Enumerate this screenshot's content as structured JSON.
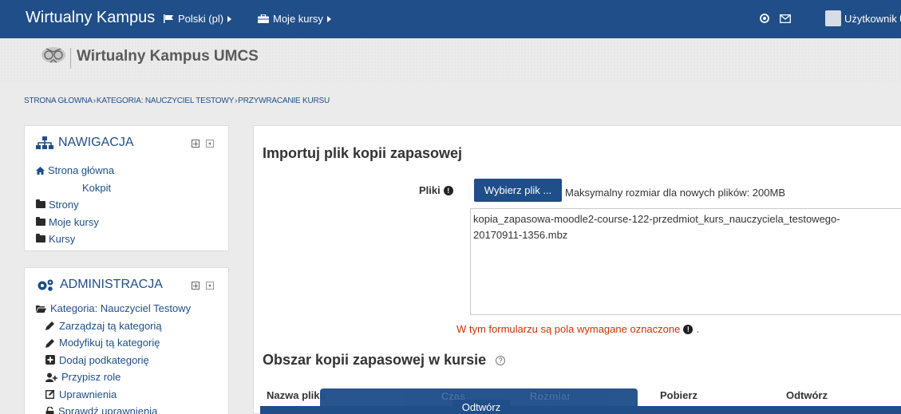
{
  "navbar": {
    "brand": "Wirtualny Kampus",
    "language": "Polski (pl)",
    "my_courses": "Moje kursy",
    "user": "Użytkownik"
  },
  "header": {
    "logo_text": "Wirtualny Kampus UMCS"
  },
  "breadcrumb": [
    "STRONA GŁOWNA",
    "KATEGORIA: NAUCZYCIEL TESTOWY",
    "PRZYWRACANIE KURSU"
  ],
  "navigation": {
    "title": "NAWIGACJA",
    "items": [
      "Strona główna",
      "Kokpit",
      "Strony",
      "Moje kursy",
      "Kursy"
    ]
  },
  "administration": {
    "title": "ADMINISTRACJA",
    "category": "Kategoria: Nauczyciel Testowy",
    "items": [
      "Zarządzaj tą kategorią",
      "Modyfikuj tą kategorię",
      "Dodaj podkategorię",
      "Przypisz role",
      "Uprawnienia",
      "Sprawdź uprawnienia"
    ]
  },
  "main": {
    "import_heading": "Importuj plik kopii zapasowej",
    "files_label": "Pliki",
    "choose_button": "Wybierz plik ...",
    "max_size": "Maksymalny rozmiar dla nowych plików: 200MB",
    "filename": "kopia_zapasowa-moodle2-course-122-przedmiot_kurs_nauczyciela_testowego-20170911-1356.mbz",
    "required_note": "W tym formularzu są pola wymagane oznaczone",
    "backup_heading": "Obszar kopii zapasowej w kursie",
    "columns": [
      "Nazwa pliku",
      "Czas",
      "Rozmiar",
      "Pobierz",
      "Odtwórz"
    ],
    "restore_button": "Odtwórz"
  },
  "colors": {
    "brand": "#1f4e88",
    "required": "#cc3300"
  }
}
